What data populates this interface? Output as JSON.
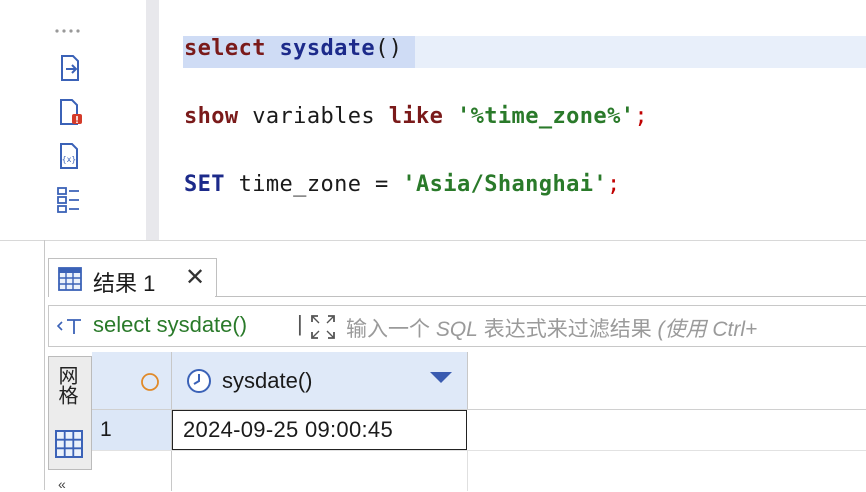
{
  "editor": {
    "lines": [
      {
        "kw": "select",
        "ident": "sysdate",
        "rest": "()"
      },
      {
        "kw": "show",
        "mid": "variables",
        "kw2": "like",
        "str": "'%time_zone%'",
        "semi": ";"
      },
      {
        "kw": "SET",
        "mid": "time_zone =",
        "str": "'Asia/Shanghai'",
        "semi": ";"
      }
    ]
  },
  "toolbar_icons": [
    "drag-handle-icon",
    "execute-script-icon",
    "error-log-icon",
    "variables-icon",
    "outline-icon"
  ],
  "results": {
    "tab_label": "结果 1",
    "close_glyph": "✕",
    "filter_query": "select sysdate()",
    "filter_separator": "|",
    "filter_placeholder_normal": "输入一个 ",
    "filter_placeholder_sql": "SQL",
    "filter_placeholder_rest": " 表达式来过滤结果 ",
    "filter_placeholder_hint": "(使用 Ctrl+",
    "side_tab_label": "网格",
    "side_more": "«",
    "column": {
      "name": "sysdate()"
    },
    "rows": [
      {
        "index": "1",
        "sysdate": "2024-09-25 09:00:45"
      }
    ]
  },
  "colors": {
    "keyword_red": "#7a1a1a",
    "keyword_blue": "#1c2a8a",
    "string_green": "#2a7a2a",
    "header_bg": "#dfe9f8",
    "selection": "#cfdcf5"
  }
}
